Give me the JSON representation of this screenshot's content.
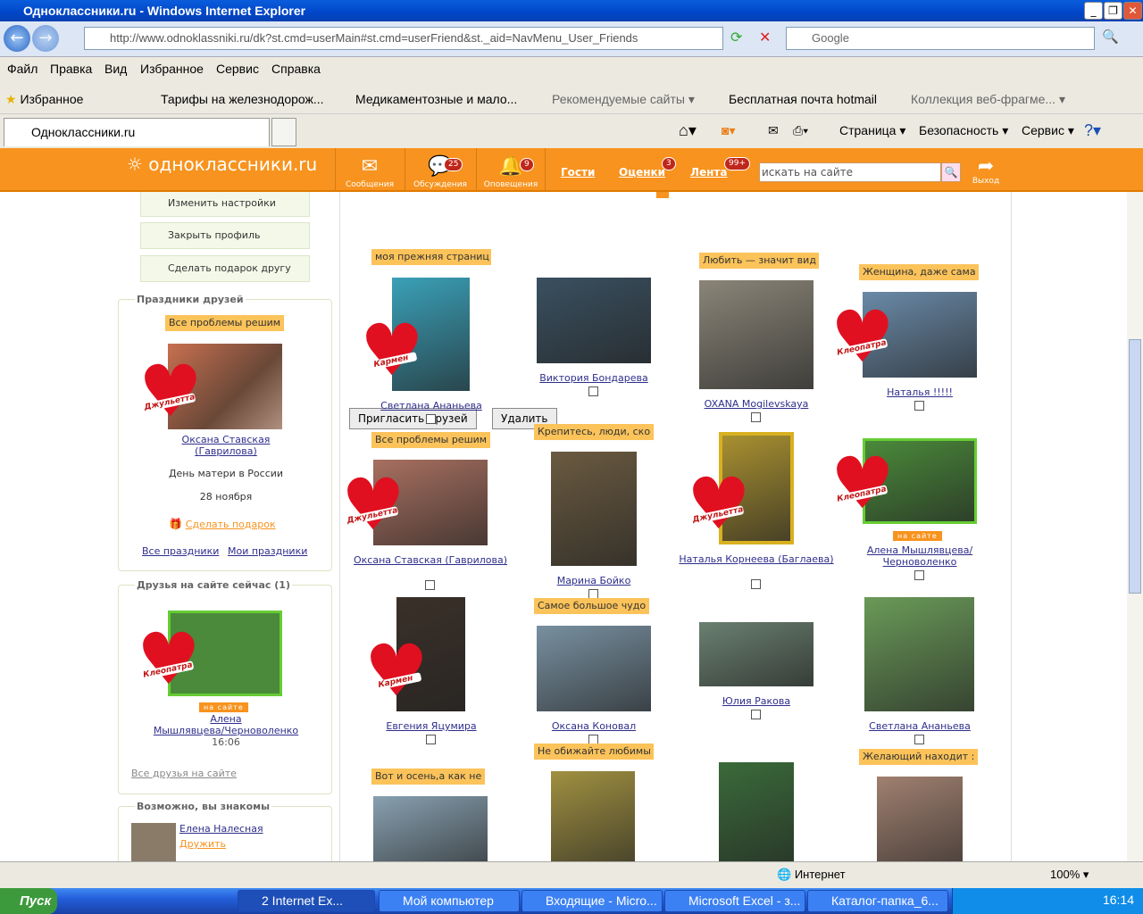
{
  "window": {
    "title": "Одноклассники.ru - Windows Internet Explorer"
  },
  "address": {
    "url": "http://www.odnoklassniki.ru/dk?st.cmd=userMain#st.cmd=userFriend&st._aid=NavMenu_User_Friends",
    "search_placeholder": "Google"
  },
  "menu": [
    "Файл",
    "Правка",
    "Вид",
    "Избранное",
    "Сервис",
    "Справка"
  ],
  "favorites": {
    "label": "Избранное",
    "items": [
      "Тарифы на железнодорож...",
      "Медикаментозные и мало...",
      "Рекомендуемые сайты ▾",
      "Бесплатная почта hotmail",
      "Коллекция веб-фрагме... ▾"
    ]
  },
  "tab": {
    "title": "Одноклассники.ru"
  },
  "commandbar": [
    "Страница ▾",
    "Безопасность ▾",
    "Сервис ▾"
  ],
  "site": {
    "logo": "одноклассники.ru",
    "nav": [
      {
        "label": "Сообщения",
        "count": ""
      },
      {
        "label": "Обсуждения",
        "count": "25"
      },
      {
        "label": "Оповещения",
        "count": "9"
      }
    ],
    "links": [
      {
        "label": "Гости",
        "count": ""
      },
      {
        "label": "Оценки",
        "count": "3"
      },
      {
        "label": "Лента",
        "count": "99+"
      }
    ],
    "search_placeholder": "искать на сайте",
    "logout": "Выход"
  },
  "sidebar": {
    "buttons": [
      "Изменить настройки",
      "Закрыть профиль",
      "Сделать подарок другу"
    ],
    "holidays": {
      "title": "Праздники друзей",
      "caption": "Все проблемы решим",
      "sticker": "Джульетта",
      "name1": "Оксана Ставская",
      "name2": "(Гаврилова)",
      "event": "День матери в России",
      "date": "28 ноября",
      "gift": "Сделать подарок",
      "all": "Все праздники",
      "mine": "Мои праздники"
    },
    "online": {
      "title": "Друзья на сайте сейчас (1)",
      "sticker": "Клеопатра",
      "badge": "на сайте",
      "name1": "Алена",
      "name2": "Мышлявцева/Черноволенко",
      "time": "16:06",
      "all": "Все друзья на сайте"
    },
    "maybe": {
      "title": "Возможно, вы знакомы",
      "name": "Елена Налесная",
      "action": "Дружить"
    }
  },
  "actions": {
    "invite": "Пригласить друзей",
    "delete": "Удалить"
  },
  "friends": [
    {
      "caption": "моя прежняя страниц",
      "name": "Светлана Ананьева",
      "sticker": "Кармен",
      "color": "#3aa0b8"
    },
    {
      "caption": "",
      "name": "Виктория Бондарева",
      "sticker": "",
      "color": "#3a5060"
    },
    {
      "caption": "Любить — значит вид",
      "name": "OXANA Mogilevskaya",
      "sticker": "",
      "color": "#8a8578"
    },
    {
      "caption": "Женщина, даже сама",
      "name": "Наталья !!!!!",
      "sticker": "Клеопатра",
      "color": "#6a8aa8"
    },
    {
      "caption": "Все проблемы решим",
      "name": "Оксана Ставская (Гаврилова)",
      "sticker": "Джульетта",
      "color": "#a87060"
    },
    {
      "caption": "Крепитесь, люди, ско",
      "name": "Марина Бойко",
      "sticker": "",
      "color": "#6a5a40"
    },
    {
      "caption": "",
      "name": "Наталья Корнеева (Баглаева)",
      "sticker": "Джульетта",
      "color": "#a89030"
    },
    {
      "caption": "",
      "name": "Алена Мышлявцева/Черноволенко",
      "sticker": "Клеопатра",
      "badge": "на сайте",
      "color": "#4a8a3a"
    },
    {
      "caption": "",
      "name": "Евгения Яцумира",
      "sticker": "Кармен",
      "color": "#3a3028"
    },
    {
      "caption": "Самое большое чудо",
      "name": "Оксана Коновал",
      "sticker": "",
      "color": "#7890a0"
    },
    {
      "caption": "",
      "name": "Юлия Ракова",
      "sticker": "",
      "color": "#6a8070"
    },
    {
      "caption": "",
      "name": "Светлана Ананьева",
      "sticker": "",
      "color": "#6a9a58"
    },
    {
      "caption": "Вот и осень,а как не",
      "name": "",
      "sticker": "",
      "color": "#88a0b0"
    },
    {
      "caption": "Не обижайте любимы",
      "name": "",
      "sticker": "",
      "color": "#a09040"
    },
    {
      "caption": "",
      "name": "",
      "sticker": "",
      "color": "#3a6a3a"
    },
    {
      "caption": "Желающий находит :",
      "name": "",
      "sticker": "",
      "color": "#a08070"
    }
  ],
  "status": {
    "zone": "Интернет",
    "zoom": "100%"
  },
  "taskbar": {
    "start": "Пуск",
    "tasks": [
      "2 Internet Ex...",
      "Мой компьютер",
      "Входящие - Micro...",
      "Microsoft Excel - з...",
      "Каталог-папка_6..."
    ],
    "clock": "16:14"
  }
}
